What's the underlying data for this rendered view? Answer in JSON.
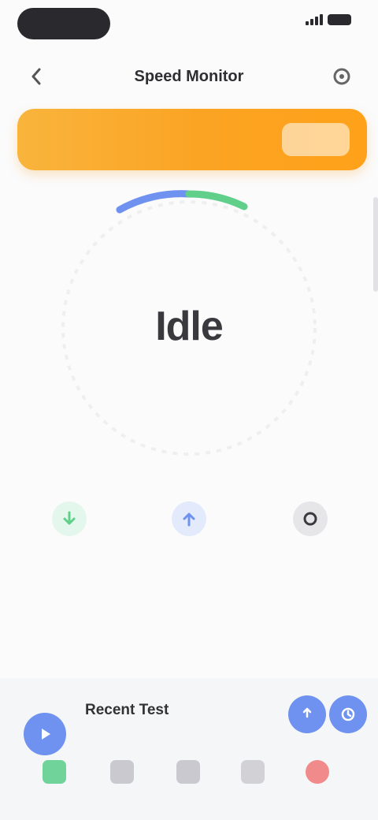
{
  "status_bar": {
    "pill_text": "",
    "time": ""
  },
  "nav": {
    "title": "Speed Monitor",
    "back_icon": "chevron-left-icon",
    "settings_icon": "gear-icon"
  },
  "banner": {
    "text": "",
    "button_label": ""
  },
  "gauge": {
    "value": "Idle",
    "unit": "",
    "ping": "",
    "left_label": "",
    "right_label": ""
  },
  "stats": [
    {
      "value": "",
      "label": "",
      "color": "#5fcf8a",
      "icon": "download-icon"
    },
    {
      "value": "",
      "label": "",
      "color": "#6f92f0",
      "icon": "upload-icon"
    },
    {
      "value": "",
      "label": "",
      "color": "#3a3a3e",
      "icon": "ping-icon"
    }
  ],
  "bottom": {
    "title": "Recent Test"
  },
  "tabs": [
    {
      "label": "",
      "color": "#6fd39a"
    },
    {
      "label": "",
      "color": "#c9c9cf"
    },
    {
      "label": "",
      "color": "#c9c9cf"
    },
    {
      "label": "",
      "color": "#d2d2d6"
    },
    {
      "label": "",
      "color": "#f18b8b"
    }
  ],
  "colors": {
    "accent_orange": "#fba322",
    "accent_blue": "#6f92f0",
    "accent_green": "#5fcf8a"
  }
}
